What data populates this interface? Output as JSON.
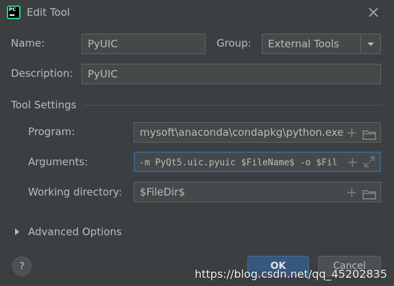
{
  "window": {
    "title": "Edit Tool",
    "app_icon_text": "PC",
    "close_icon": "close-icon"
  },
  "form": {
    "name_label": "Name:",
    "name_value": "PyUIC",
    "group_label": "Group:",
    "group_value": "External Tools",
    "description_label": "Description:",
    "description_value": "PyUIC"
  },
  "tool_settings": {
    "section_title": "Tool Settings",
    "program_label": "Program:",
    "program_value": "mysoft\\anaconda\\condapkg\\python.exe",
    "arguments_label": "Arguments:",
    "arguments_value": "-m PyQt5.uic.pyuic $FileName$ -o $Fil",
    "workdir_label": "Working directory:",
    "workdir_value": "$FileDir$"
  },
  "advanced": {
    "label": "Advanced Options"
  },
  "buttons": {
    "help": "?",
    "ok": "OK",
    "cancel": "Cancel"
  },
  "watermark": "https://blog.csdn.net/qq_45202835",
  "colors": {
    "background": "#3c3f41",
    "field": "#45494a",
    "focus_border": "#3d6185",
    "ok_button": "#365880",
    "text": "#bbbbbb"
  }
}
